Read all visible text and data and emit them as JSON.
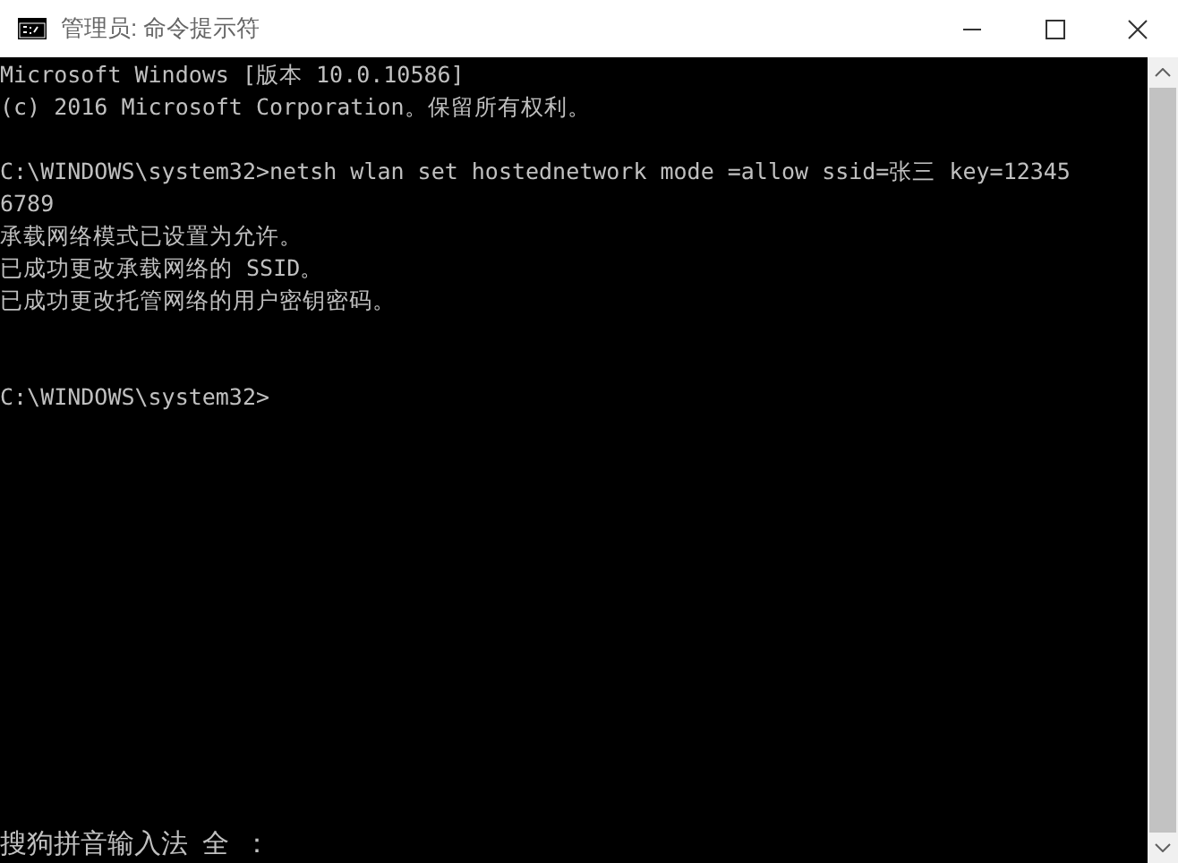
{
  "window": {
    "title": "管理员: 命令提示符"
  },
  "console": {
    "blocks": [
      {
        "lines": [
          "Microsoft Windows [版本 10.0.10586]",
          "(c) 2016 Microsoft Corporation。保留所有权利。"
        ]
      },
      {
        "lines": [
          "C:\\WINDOWS\\system32>netsh wlan set hostednetwork mode =allow ssid=张三 key=12345",
          "6789",
          "承载网络模式已设置为允许。",
          "已成功更改承载网络的 SSID。",
          "已成功更改托管网络的用户密钥密码。"
        ]
      }
    ],
    "prompt": "C:\\WINDOWS\\system32>"
  },
  "ime_bar": {
    "name": "搜狗拼音输入法",
    "mode": "全",
    "punctuation": "："
  }
}
